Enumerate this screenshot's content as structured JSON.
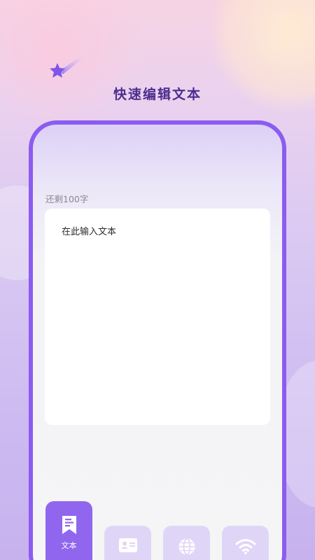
{
  "header": {
    "title": "快速编辑文本"
  },
  "editor": {
    "remaining_label": "还剩100字",
    "placeholder": "在此输入文本"
  },
  "tabs": [
    {
      "label": "文本",
      "icon": "bookmark-text-icon",
      "selected": true
    },
    {
      "label": "",
      "icon": "id-card-icon",
      "selected": false
    },
    {
      "label": "",
      "icon": "globe-icon",
      "selected": false
    },
    {
      "label": "",
      "icon": "wifi-icon",
      "selected": false
    }
  ],
  "colors": {
    "accent": "#8b5cf0",
    "tab_active": "#9066ef",
    "tab_inactive": "#dfd6f7",
    "title": "#4b2e8e"
  }
}
